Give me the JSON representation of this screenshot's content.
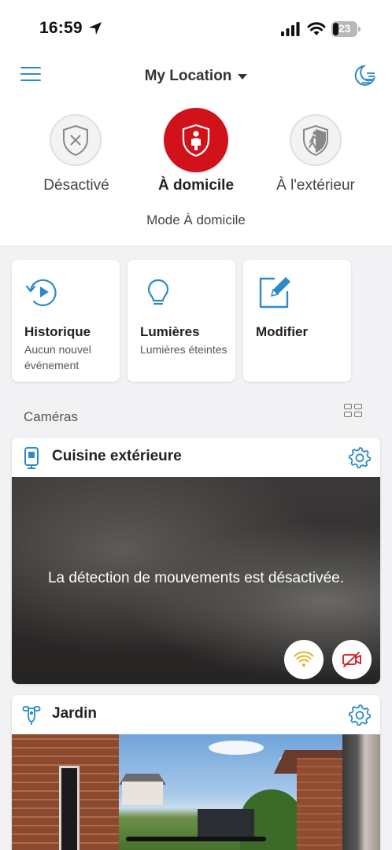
{
  "status_bar": {
    "time": "16:59",
    "battery": "23",
    "icons": [
      "location-arrow-icon",
      "cellular-signal-icon",
      "wifi-icon",
      "battery-icon"
    ]
  },
  "header": {
    "location": "My Location",
    "icons": [
      "hamburger-menu-icon",
      "chevron-down-icon",
      "night-mode-moon-icon"
    ]
  },
  "modes": {
    "items": [
      {
        "label": "Désactivé",
        "icon": "shield-x-icon",
        "active": false
      },
      {
        "label": "À domicile",
        "icon": "shield-person-icon",
        "active": true
      },
      {
        "label": "À l'extérieur",
        "icon": "shield-running-person-icon",
        "active": false
      }
    ],
    "status": "Mode À domicile",
    "active_color": "#d2121a"
  },
  "tiles": [
    {
      "title": "Historique",
      "subtitle": "Aucun nouvel événement",
      "icon": "history-play-icon"
    },
    {
      "title": "Lumières",
      "subtitle": "Lumières éteintes",
      "icon": "lightbulb-icon"
    },
    {
      "title": "Modifier",
      "subtitle": "",
      "icon": "edit-pencil-icon"
    }
  ],
  "cameras": {
    "section_label": "Caméras",
    "items": [
      {
        "name": "Cuisine extérieure",
        "icon": "stick-up-cam-icon",
        "message": "La détection de mouvements est désactivée.",
        "buttons": [
          "wifi-signal-icon",
          "camera-off-icon"
        ]
      },
      {
        "name": "Jardin",
        "icon": "floodlight-cam-icon"
      }
    ]
  },
  "colors": {
    "accent": "#2b8bc8",
    "alarm_red": "#d2121a",
    "wifi_yellow": "#e6b422"
  }
}
